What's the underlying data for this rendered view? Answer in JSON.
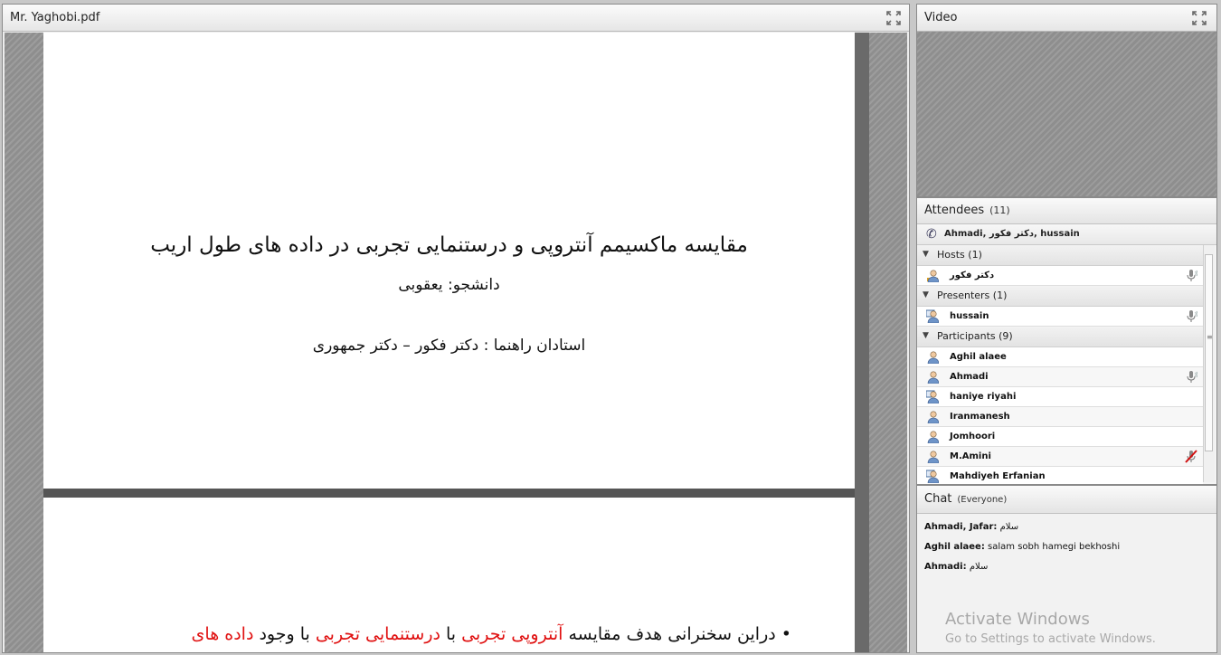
{
  "pdf_pod": {
    "title": "Mr. Yaghobi.pdf",
    "slide1": {
      "title": "مقایسه ماکسیمم آنتروپی و درستنمایی تجربی در داده های طول اریب",
      "student": "دانشجو: یعقوبی",
      "advisors": "استادان راهنما : دکتر فکور – دکتر جمهوری"
    },
    "slide2": {
      "bullet": "•",
      "part1": "دراین سخنرانی هدف مقایسه ",
      "part2_red": "آنتروپی تجربی",
      "part3": " با ",
      "part4_red": "درستنمایی تجربی",
      "part5": " با وجود ",
      "part6_red": "داده های"
    }
  },
  "video_pod": {
    "title": "Video"
  },
  "attendees_pod": {
    "title": "Attendees",
    "count": "(11)",
    "speaking": "Ahmadi, دکتر فکور, hussain",
    "groups": [
      {
        "label": "Hosts (1)",
        "members": [
          {
            "name": "دکتر فکور",
            "role": "host",
            "mic": "on"
          }
        ]
      },
      {
        "label": "Presenters (1)",
        "members": [
          {
            "name": "hussain",
            "role": "presenter",
            "mic": "on"
          }
        ]
      },
      {
        "label": "Participants (9)",
        "members": [
          {
            "name": "Aghil alaee",
            "role": "participant",
            "mic": ""
          },
          {
            "name": "Ahmadi",
            "role": "participant",
            "mic": "on"
          },
          {
            "name": "haniye riyahi",
            "role": "participant-screen",
            "mic": ""
          },
          {
            "name": "Iranmanesh",
            "role": "participant",
            "mic": ""
          },
          {
            "name": "Jomhoori",
            "role": "participant",
            "mic": ""
          },
          {
            "name": "M.Amini",
            "role": "participant",
            "mic": "muted"
          },
          {
            "name": "Mahdiyeh Erfanian",
            "role": "participant-screen",
            "mic": ""
          }
        ]
      }
    ]
  },
  "chat_pod": {
    "title": "Chat",
    "scope": "(Everyone)",
    "messages": [
      {
        "sender": "Ahmadi, Jafar:",
        "text": "سلام"
      },
      {
        "sender": "Aghil alaee:",
        "text": "salam sobh hamegi bekhoshi"
      },
      {
        "sender": "Ahmadi:",
        "text": "سلام"
      }
    ]
  },
  "watermark": {
    "line1": "Activate Windows",
    "line2": "Go to Settings to activate Windows."
  },
  "icons": {
    "maximize": "maximize-icon",
    "phone": "phone-icon",
    "user": "user-icon",
    "mic": "microphone-icon",
    "muted": "microphone-muted-icon"
  }
}
